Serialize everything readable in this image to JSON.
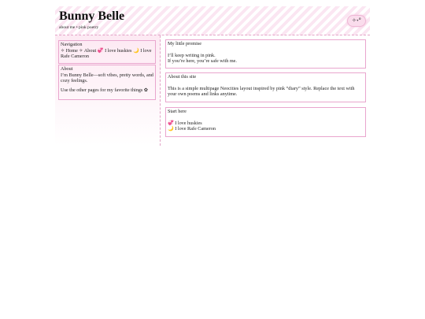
{
  "header": {
    "title": "Bunny Belle",
    "subtitle": "about me • pink poetry",
    "sparkle_button": "✧˖°"
  },
  "sidebar": {
    "nav": {
      "heading": "Navigation",
      "items": [
        {
          "label": "✧ Home"
        },
        {
          "label": "✧ About 💞"
        },
        {
          "label": "I love huskies 🌙"
        },
        {
          "label": "I love Rafe Cameron"
        }
      ]
    },
    "about": {
      "heading": "About",
      "text1": "I’m Bunny Belle—soft vibes, pretty words, and cozy feelings.",
      "text2": "Use the other pages for my favorite things ✿"
    }
  },
  "main": {
    "promise": {
      "heading": "My little promise",
      "line1": "I’ll keep writing in pink.",
      "line2": "If you’re here, you’re safe with me."
    },
    "about_site": {
      "heading": "About this site",
      "text": "This is a simple multipage Neocities layout inspired by pink “diary” style. Replace the text with your own poems and links anytime."
    },
    "start": {
      "heading": "Start here",
      "link1": "💞 I love huskies",
      "link2": "🌙 I love Rafe Cameron"
    }
  },
  "colors": {
    "accent": "#e9a6ce",
    "stripe": "#fbe6f2",
    "button_bg": "#fadcec"
  }
}
